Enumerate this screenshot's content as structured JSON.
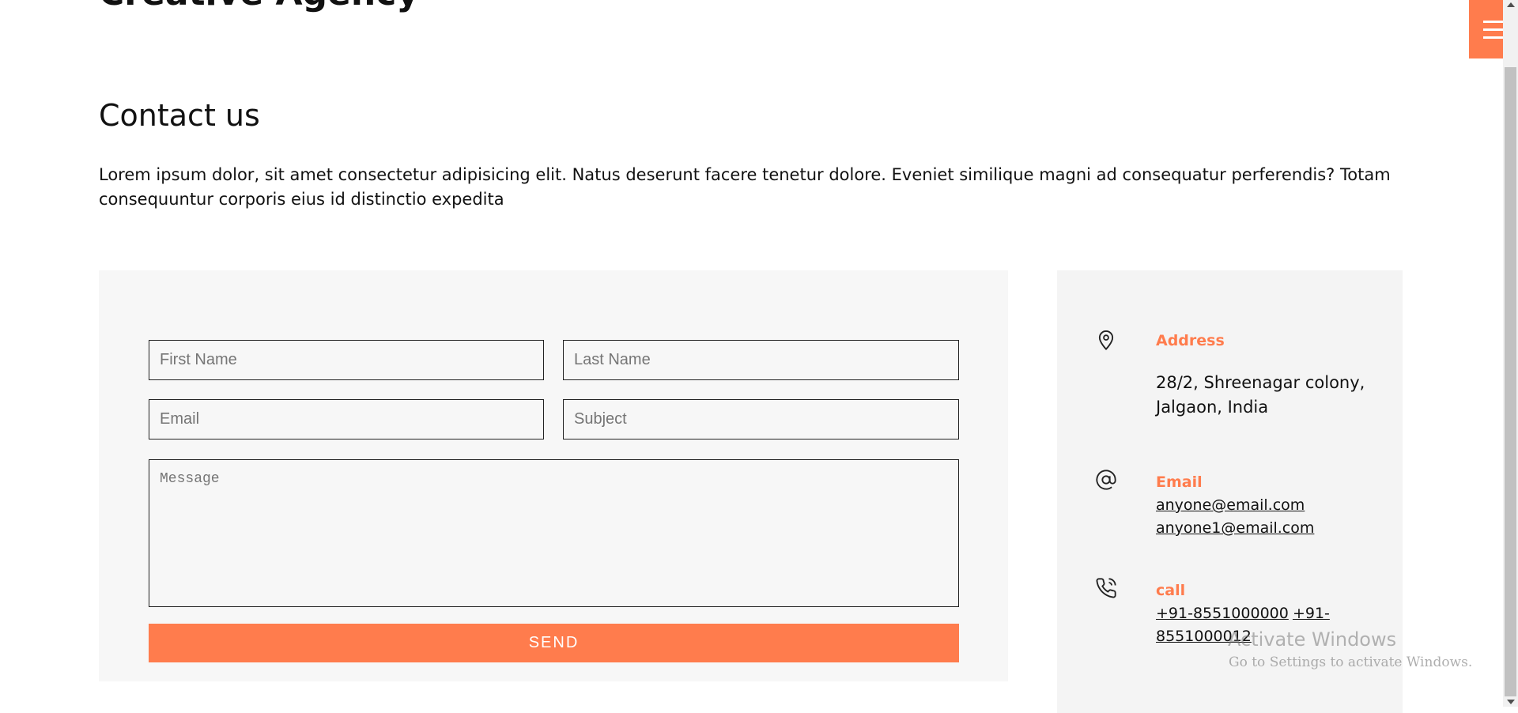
{
  "header": {
    "brand": "Creative Agency",
    "menu_icon": "hamburger-menu-icon",
    "accent_color": "#ff7c4d"
  },
  "contact": {
    "heading": "Contact us",
    "intro": "Lorem ipsum dolor, sit amet consectetur adipisicing elit. Natus deserunt facere tenetur dolore. Eveniet similique magni ad consequatur perferendis? Totam consequuntur corporis eius id distinctio expedita"
  },
  "form": {
    "first_name_placeholder": "First Name",
    "last_name_placeholder": "Last Name",
    "email_placeholder": "Email",
    "subject_placeholder": "Subject",
    "message_placeholder": "Message",
    "send_label": "SEND"
  },
  "info": {
    "address": {
      "icon": "map-pin-icon",
      "label": "Address",
      "line1": "28/2, Shreenagar colony,",
      "line2": "Jalgaon, India"
    },
    "email": {
      "icon": "at-sign-icon",
      "label": "Email",
      "emails": [
        "anyone@email.com",
        "anyone1@email.com"
      ]
    },
    "call": {
      "icon": "phone-call-icon",
      "label": "call",
      "phones": [
        "+91-8551000000",
        "+91-8551000012"
      ]
    }
  },
  "os_overlay": {
    "title": "Activate Windows",
    "subtitle": "Go to Settings to activate Windows."
  }
}
